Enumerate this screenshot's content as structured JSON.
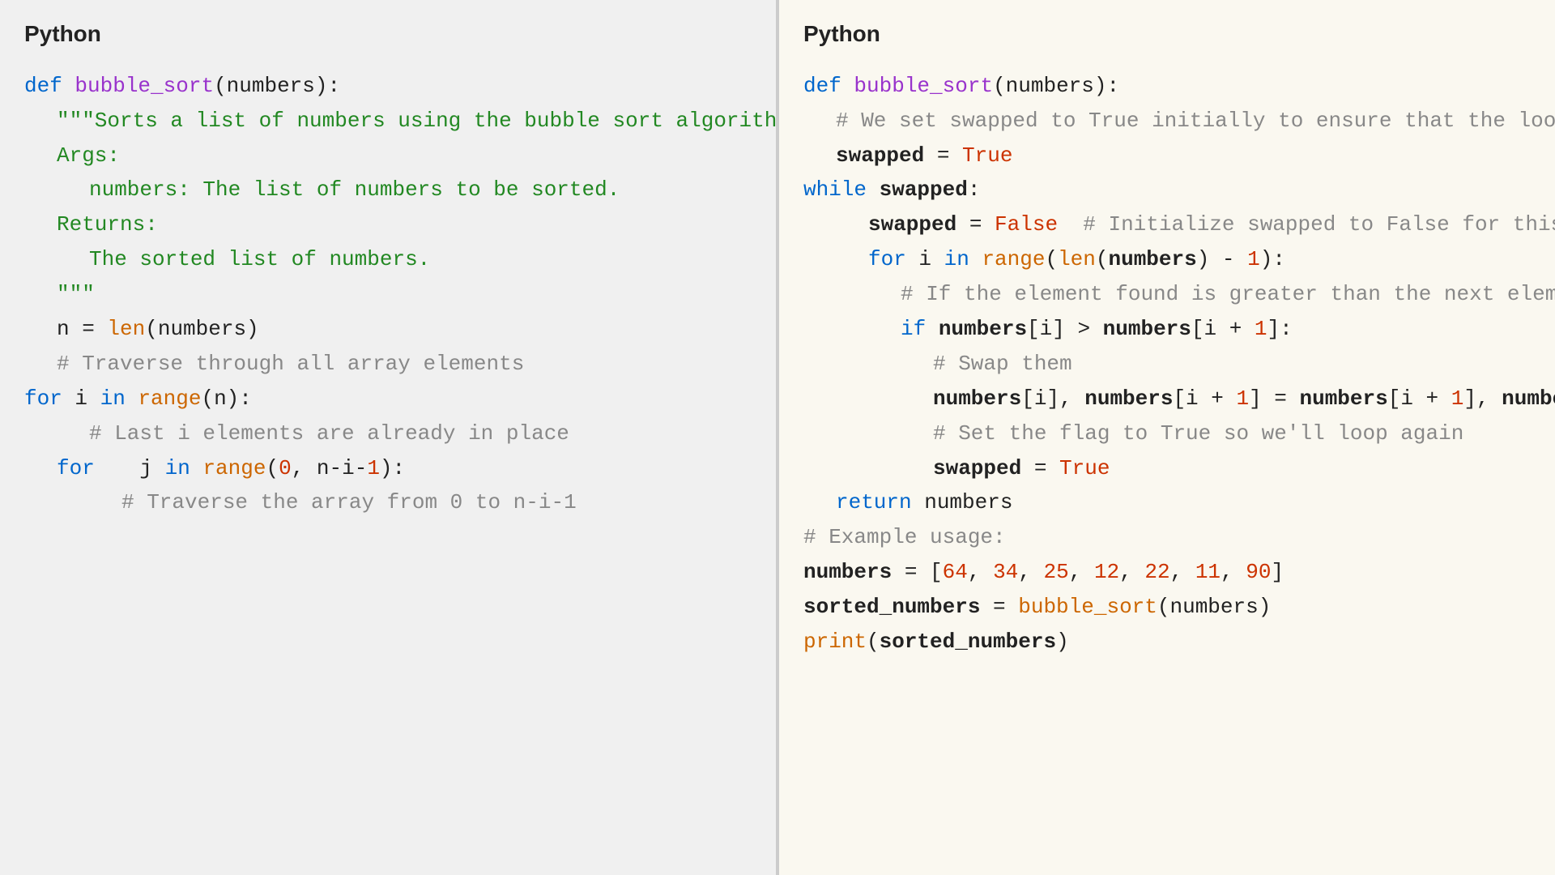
{
  "left": {
    "title": "Python",
    "lines": []
  },
  "right": {
    "title": "Python",
    "lines": []
  }
}
